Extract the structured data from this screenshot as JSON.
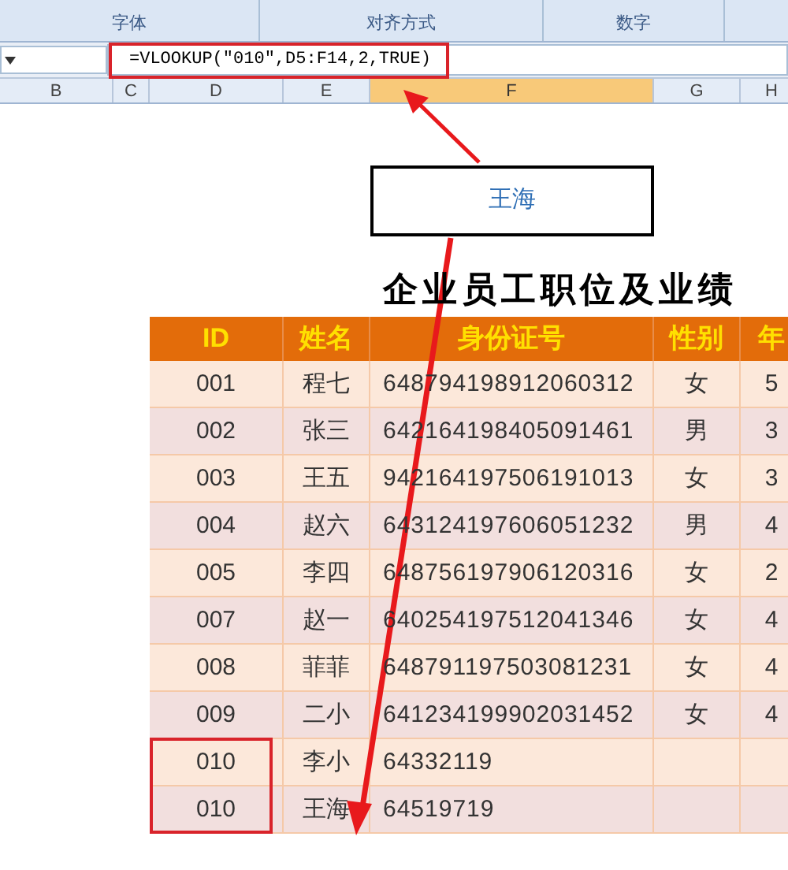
{
  "ribbon": {
    "groups": [
      {
        "label": "字体"
      },
      {
        "label": "对齐方式"
      },
      {
        "label": "数字"
      }
    ]
  },
  "formula_bar": {
    "formula": "=VLOOKUP(″010″,D5:F14,2,TRUE)"
  },
  "column_headers": [
    {
      "label": "B",
      "selected": false
    },
    {
      "label": "C",
      "selected": false
    },
    {
      "label": "D",
      "selected": false
    },
    {
      "label": "E",
      "selected": false
    },
    {
      "label": "F",
      "selected": true
    },
    {
      "label": "G",
      "selected": false
    },
    {
      "label": "H",
      "selected": false
    }
  ],
  "callout": {
    "text": "王海"
  },
  "title": "企业员工职位及业绩",
  "table": {
    "columns": [
      "ID",
      "姓名",
      "身份证号",
      "性别",
      "年"
    ],
    "rows": [
      [
        "001",
        "程七",
        "648794198912060312",
        "女",
        "5"
      ],
      [
        "002",
        "张三",
        "642164198405091461",
        "男",
        "3"
      ],
      [
        "003",
        "王五",
        "942164197506191013",
        "女",
        "3"
      ],
      [
        "004",
        "赵六",
        "643124197606051232",
        "男",
        "4"
      ],
      [
        "005",
        "李四",
        "648756197906120316",
        "女",
        "2"
      ],
      [
        "007",
        "赵一",
        "640254197512041346",
        "女",
        "4"
      ],
      [
        "008",
        "菲菲",
        "648791197503081231",
        "女",
        "4"
      ],
      [
        "009",
        "二小",
        "641234199902031452",
        "女",
        "4"
      ],
      [
        "010",
        "李小",
        "64332119",
        "",
        ""
      ],
      [
        "010",
        "王海",
        "64519719",
        "",
        ""
      ]
    ]
  }
}
